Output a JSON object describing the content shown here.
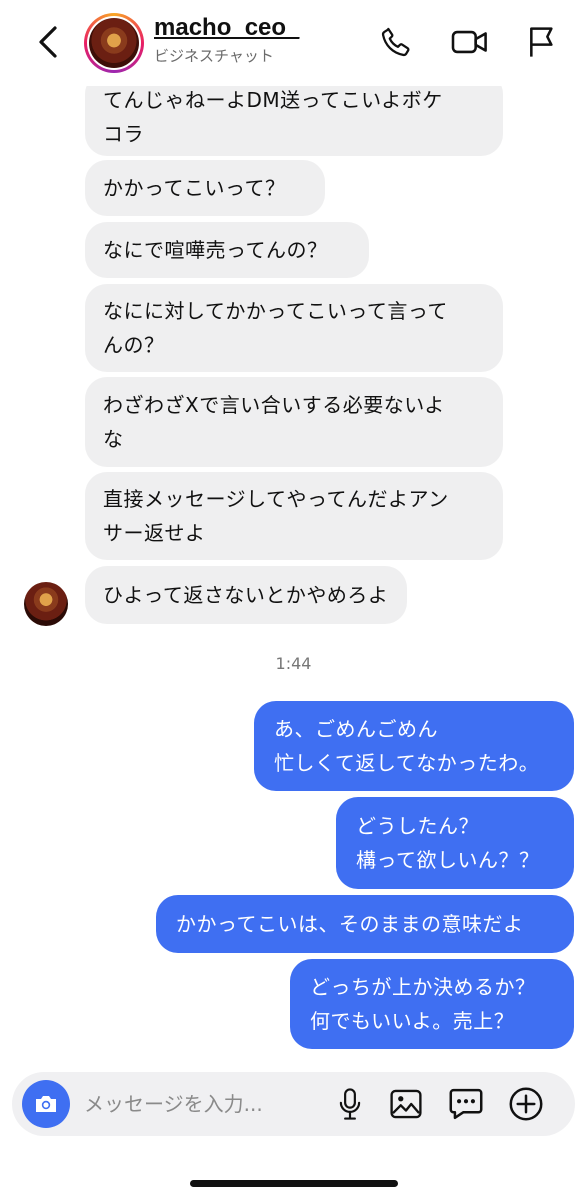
{
  "header": {
    "username": "macho_ceo_",
    "subtitle": "ビジネスチャット"
  },
  "incoming": [
    {
      "text": "てんじゃねーよDM送ってこいよボケ\nコラ"
    },
    {
      "text": "かかってこいって？"
    },
    {
      "text": "なにで喧嘩売ってんの？"
    },
    {
      "text": "なにに対してかかってこいって言って\nんの？"
    },
    {
      "text": "わざわざXで言い合いする必要ないよ\nな"
    },
    {
      "text": "直接メッセージしてやってんだよアン\nサー返せよ"
    },
    {
      "text": "ひよって返さないとかやめろよ"
    }
  ],
  "timestamp": "1:44",
  "outgoing": [
    {
      "text": "あ、ごめんごめん\n忙しくて返してなかったわ。"
    },
    {
      "text": "どうしたん？\n構って欲しいん？？"
    },
    {
      "text": "かかってこいは、そのままの意味だよ"
    },
    {
      "text": "どっちが上か決めるか？\n何でもいいよ。売上？"
    }
  ],
  "composer": {
    "placeholder": "メッセージを入力..."
  },
  "colors": {
    "outgoing_bubble": "#3f6ff2",
    "incoming_bubble": "#efeff0"
  }
}
